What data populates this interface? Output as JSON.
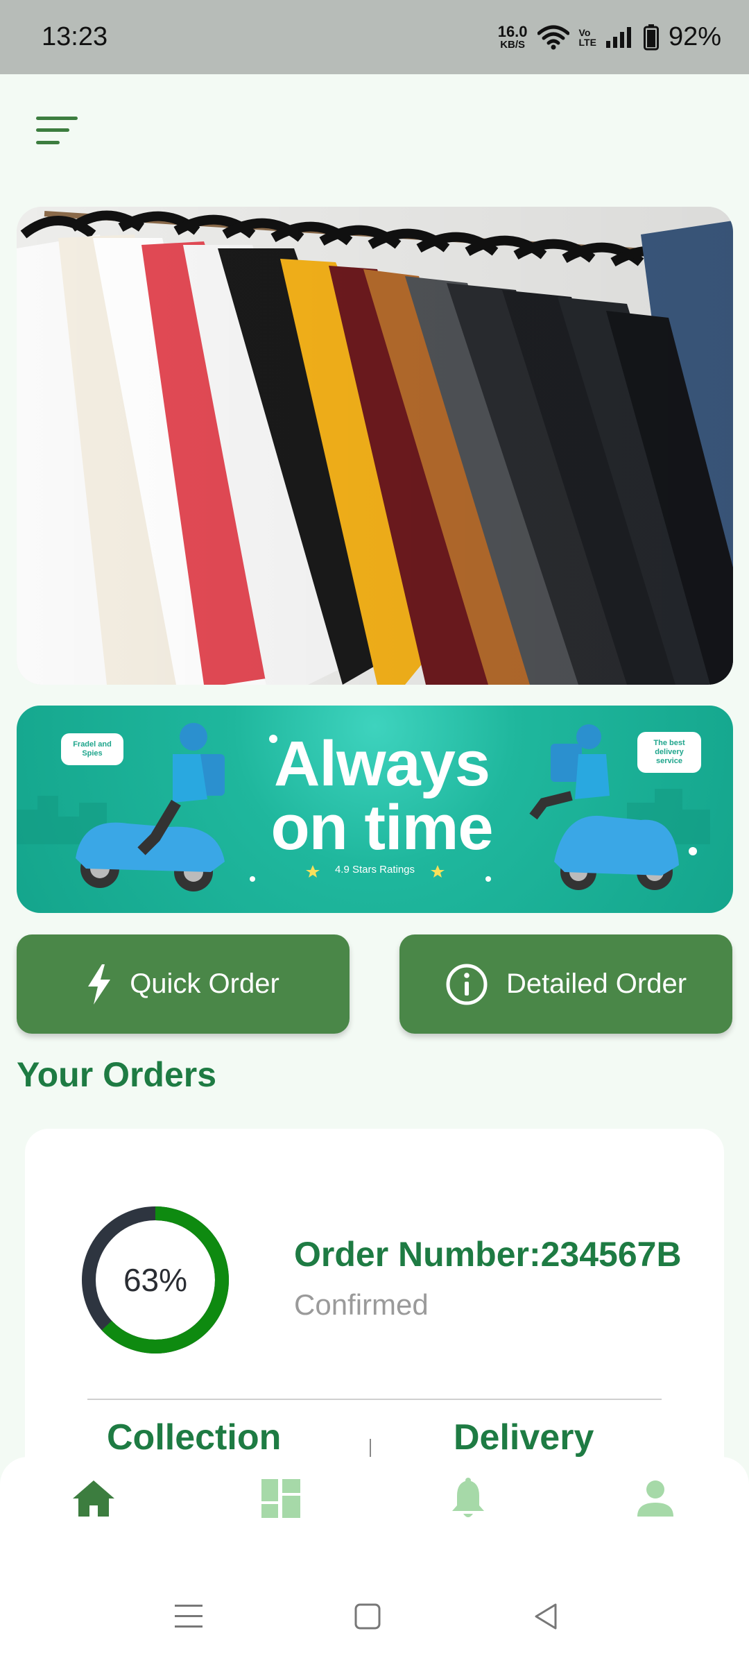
{
  "status_bar": {
    "time": "13:23",
    "net_speed_value": "16.0",
    "net_speed_unit": "KB/S",
    "volte_line1": "Vo",
    "volte_line2": "LTE",
    "battery": "92%"
  },
  "banner": {
    "title_line1": "Always",
    "title_line2": "on time",
    "subtitle": "4.9 Stars Ratings",
    "bubble_left": "Fradel and Spies",
    "bubble_right": "The best delivery service"
  },
  "actions": {
    "quick_order": "Quick Order",
    "detailed_order": "Detailed Order"
  },
  "orders": {
    "section_title": "Your Orders",
    "card": {
      "progress_label": "63%",
      "progress_value": 0.63,
      "order_number": "Order Number:234567B",
      "status": "Confirmed",
      "collection_label": "Collection",
      "delivery_label": "Delivery"
    }
  },
  "bottom_nav": {
    "items": [
      "home-icon",
      "dashboard-icon",
      "bell-icon",
      "profile-icon"
    ],
    "active": "home-icon"
  },
  "colors": {
    "primary": "#4a8748",
    "accent_text": "#1e7b43",
    "ring_progress": "#0e8a10",
    "ring_track": "#2e3540",
    "banner_bg": "#1fb79d"
  }
}
